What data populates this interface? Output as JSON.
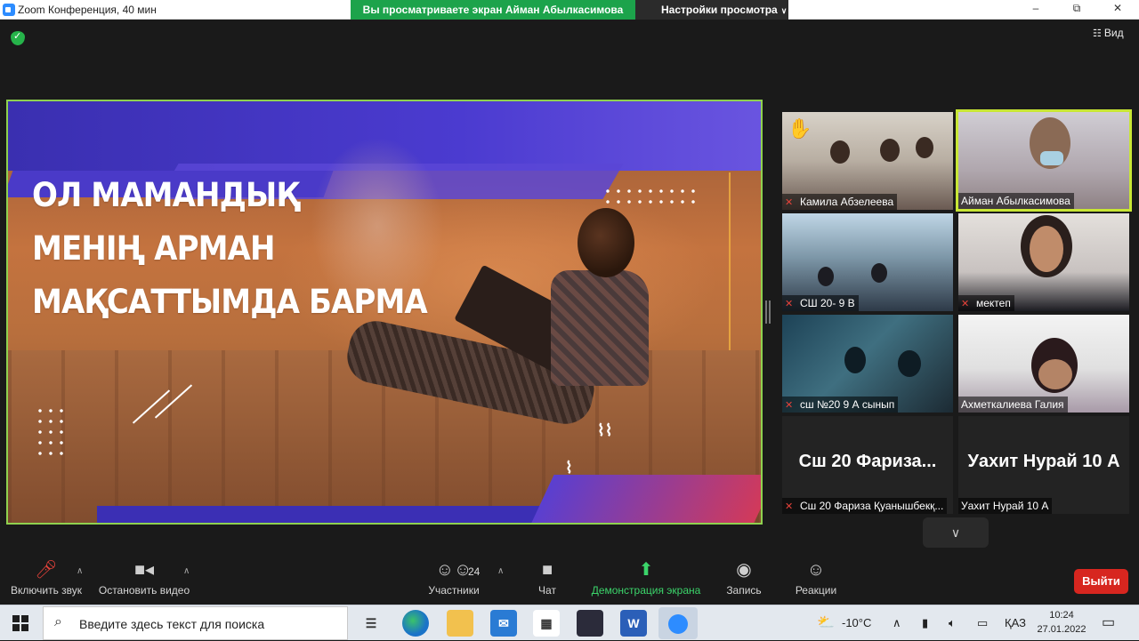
{
  "window": {
    "title": "Zoom Конференция, 40 мин",
    "share_banner": "Вы просматриваете экран Айман Абылкасимова",
    "view_settings": "Настройки просмотра",
    "minimize": "–",
    "maximize": "⧉",
    "close": "✕"
  },
  "meeting": {
    "view_label": "Вид"
  },
  "slide": {
    "line1": "ОЛ МАМАНДЫҚ",
    "line2": "МЕНІҢ АРМАН",
    "line3": "МАҚСАТТЫМДА БАРМА"
  },
  "participants": [
    {
      "name": "Камила Абзелеева",
      "muted": true,
      "hand_raised": true
    },
    {
      "name": "Айман Абылкасимова",
      "muted": false,
      "active_speaker": true
    },
    {
      "name": "СШ 20- 9 В",
      "muted": true
    },
    {
      "name": "мектеп",
      "muted": true
    },
    {
      "name": "сш №20 9 А сынып",
      "muted": true
    },
    {
      "name": "Ахметкалиева Галия",
      "muted": false
    },
    {
      "name": "Сш 20 Фариза Қуанышбекқ...",
      "display_name": "Сш 20 Фариза...",
      "muted": true
    },
    {
      "name": "Уахит Нурай 10 А",
      "display_name": "Уахит Нурай 10 А",
      "muted": false
    }
  ],
  "toolbar": {
    "unmute": "Включить звук",
    "stop_video": "Остановить видео",
    "participants": "Участники",
    "participants_count": "24",
    "chat": "Чат",
    "share_screen": "Демонстрация экрана",
    "record": "Запись",
    "reactions": "Реакции",
    "leave": "Выйти"
  },
  "taskbar": {
    "search_placeholder": "Введите здесь текст для поиска",
    "weather": "-10°C",
    "language": "ҚАЗ",
    "time": "10:24",
    "date": "27.01.2022"
  },
  "colors": {
    "share_green": "#1ca34b",
    "active_border": "#c8e635",
    "leave_red": "#d7261f",
    "muted_red": "#e5423a"
  }
}
